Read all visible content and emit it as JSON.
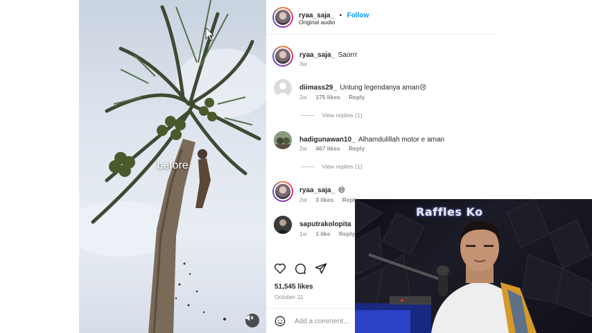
{
  "video": {
    "caption": "before",
    "mute_icon": "speaker-muted-icon"
  },
  "post": {
    "username": "ryaa_saja_",
    "separator": "•",
    "follow_label": "Follow",
    "audio": "Original audio"
  },
  "comments": [
    {
      "username": "ryaa_saja_",
      "text": "Saorrr",
      "time": "3w"
    },
    {
      "username": "diimass29_",
      "text": "Untung legendanya aman😢",
      "time": "2w",
      "likes": "175 likes",
      "reply": "Reply",
      "view_replies": "View replies (1)"
    },
    {
      "username": "hadigunawan10_",
      "text": "Alhamdulillah motor e aman",
      "time": "2w",
      "likes": "467 likes",
      "reply": "Reply",
      "view_replies": "View replies (1)"
    },
    {
      "username": "ryaa_saja_",
      "text": "😄",
      "time": "2w",
      "likes": "3 likes",
      "reply": "Reply"
    },
    {
      "username": "saputrakolopita",
      "text": "",
      "time": "1w",
      "likes": "1 like",
      "reply": "Reply"
    }
  ],
  "actions": {
    "like_icon": "heart-icon",
    "comment_icon": "comment-icon",
    "share_icon": "share-icon",
    "likes_count": "51,545 likes",
    "date": "October 11"
  },
  "add_comment": {
    "emoji_icon": "emoji-icon",
    "placeholder": "Add a comment…"
  },
  "webcam": {
    "sign_text": "Raffles Ko"
  }
}
